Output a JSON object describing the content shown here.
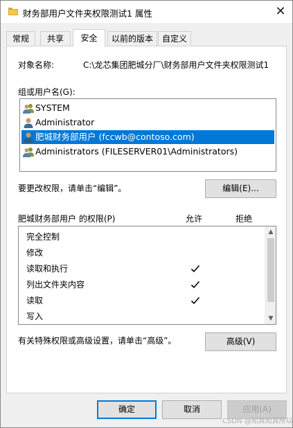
{
  "window": {
    "title": "财务部用户文件夹权限测试1 属性",
    "close_glyph": "✕"
  },
  "tabs": [
    {
      "label": "常规"
    },
    {
      "label": "共享"
    },
    {
      "label": "安全"
    },
    {
      "label": "以前的版本"
    },
    {
      "label": "自定义"
    }
  ],
  "security": {
    "object_name_label": "对象名称:",
    "object_name_value": "C:\\龙芯集团肥城分厂\\财务部用户文件夹权限测试1",
    "group_label": "组或用户名(G):",
    "principals": [
      {
        "name": "SYSTEM",
        "icon": "group-users-icon",
        "selected": false
      },
      {
        "name": "Administrator",
        "icon": "user-icon",
        "selected": false
      },
      {
        "name": "肥城财务部用户 (fccwb@contoso.com)",
        "icon": "user-icon",
        "selected": true
      },
      {
        "name": "Administrators (FILESERVER01\\Administrators)",
        "icon": "group-users-icon",
        "selected": false
      }
    ],
    "edit_hint": "要更改权限，请单击“编辑”。",
    "edit_button": "编辑(E)...",
    "permissions_label": "肥城财务部用户 的权限(P)",
    "allow_header": "允许",
    "deny_header": "拒绝",
    "permissions": [
      {
        "name": "完全控制",
        "allow": false,
        "deny": false
      },
      {
        "name": "修改",
        "allow": false,
        "deny": false
      },
      {
        "name": "读取和执行",
        "allow": true,
        "deny": false
      },
      {
        "name": "列出文件夹内容",
        "allow": true,
        "deny": false
      },
      {
        "name": "读取",
        "allow": true,
        "deny": false
      },
      {
        "name": "写入",
        "allow": false,
        "deny": false
      }
    ],
    "advanced_hint": "有关特殊权限或高级设置，请单击“高级”。",
    "advanced_button": "高级(V)"
  },
  "footer": {
    "ok": "确定",
    "cancel": "取消",
    "apply": "应用(A)"
  },
  "watermark": "CSDN @知其知其所以",
  "colors": {
    "selection": "#0078d7",
    "folder": "#f6c84f"
  }
}
